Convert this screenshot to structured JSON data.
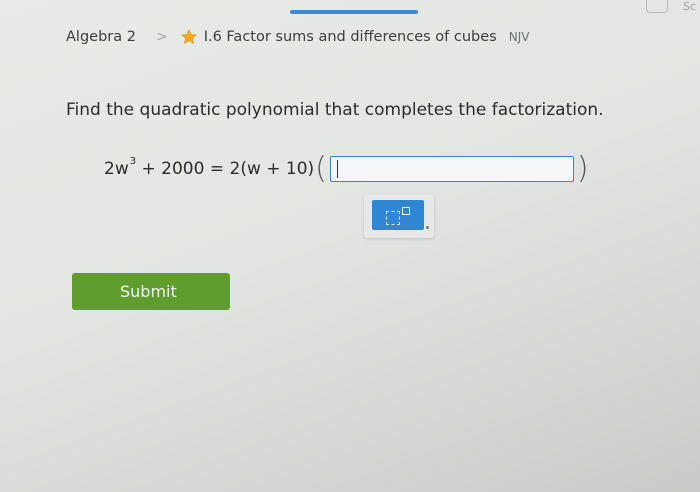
{
  "breadcrumb": {
    "course": "Algebra 2",
    "separator": ">",
    "skill_name": "I.6 Factor sums and differences of cubes",
    "skill_code": "NJV"
  },
  "corner": {
    "link_text": "Sc"
  },
  "question": {
    "prompt": "Find the quadratic polynomial that completes the factorization.",
    "equation": {
      "lhs_base": "2w",
      "lhs_exponent": "3",
      "lhs_rest": " + 2000",
      "equals": " = ",
      "rhs_factor": "2(w + 10)",
      "open_paren": "(",
      "close_paren": ")"
    },
    "answer_value": ""
  },
  "submit": {
    "label": "Submit"
  },
  "colors": {
    "accent": "#3b8ad6",
    "submit_green": "#5f9e2e",
    "star": "#f0a81c"
  }
}
